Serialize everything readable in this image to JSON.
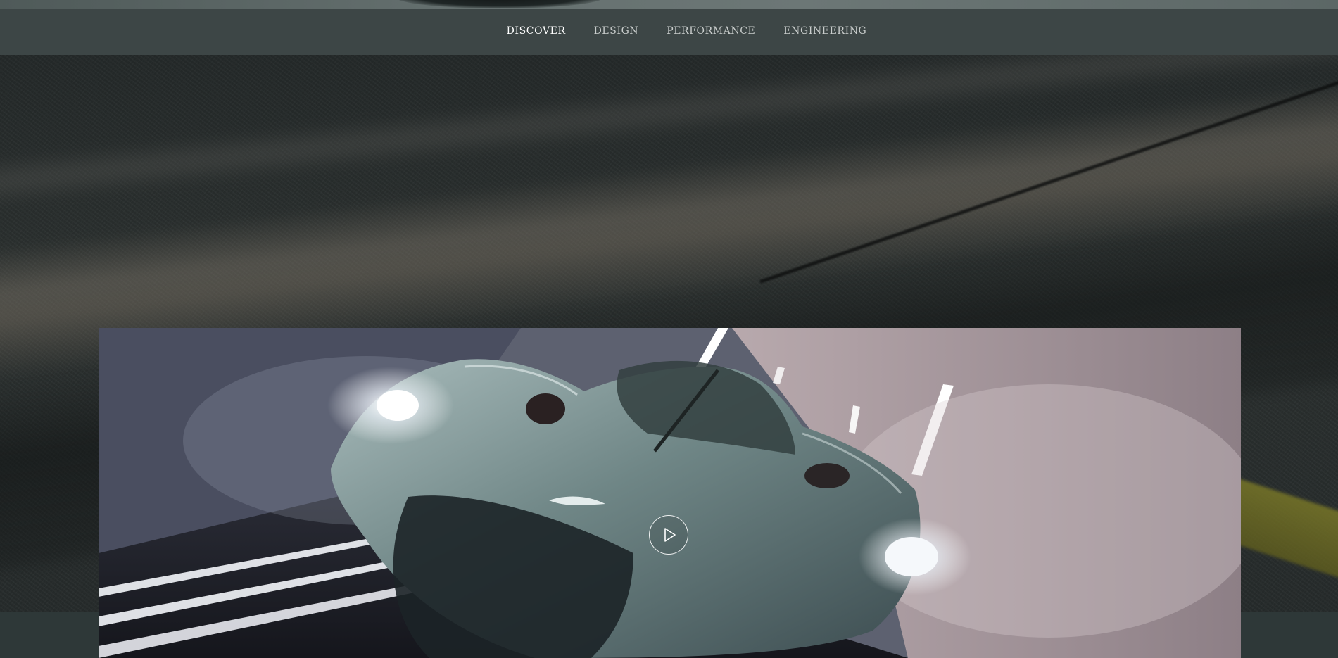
{
  "nav": {
    "items": [
      {
        "label": "DISCOVER",
        "active": true
      },
      {
        "label": "DESIGN",
        "active": false
      },
      {
        "label": "PERFORMANCE",
        "active": false
      },
      {
        "label": "ENGINEERING",
        "active": false
      }
    ]
  },
  "video": {
    "play_icon": "play-icon"
  },
  "colors": {
    "nav_bg": "#3d4646",
    "nav_text": "#c9cdcc",
    "nav_active": "#ffffff",
    "page_bg": "#2b3434"
  }
}
